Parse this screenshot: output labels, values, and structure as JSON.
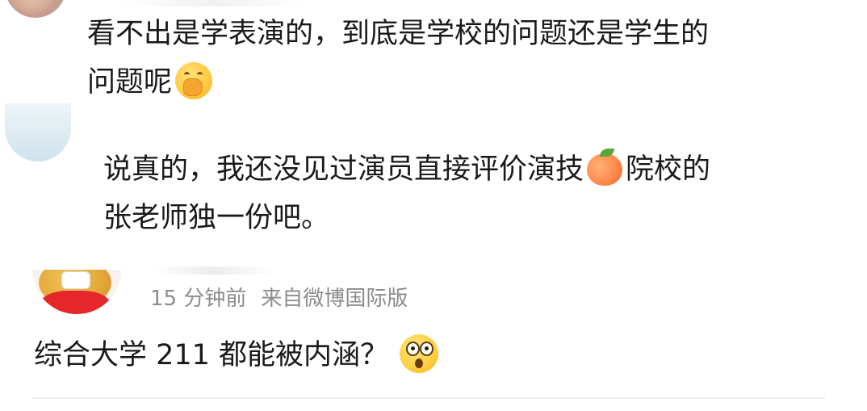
{
  "comments": [
    {
      "lines": [
        "看不出是学表演的，到底是学校的问题还是学生的",
        "问题呢"
      ],
      "emoji": "hand-over-mouth-emoji"
    },
    {
      "line1_before": "说真的，我还没见过演员直接评价演技",
      "emoji": "peach-emoji",
      "line1_after": "院校的",
      "line2": "张老师独一份吧。"
    },
    {
      "meta_time": "15 分钟前",
      "meta_source": "来自微博国际版",
      "text": "综合大学 211 都能被内涵？",
      "emoji": "astonished-face-emoji"
    }
  ],
  "colors": {
    "text": "#1a1a1a",
    "meta": "#8c8c8c",
    "divider": "#eeeeee"
  }
}
